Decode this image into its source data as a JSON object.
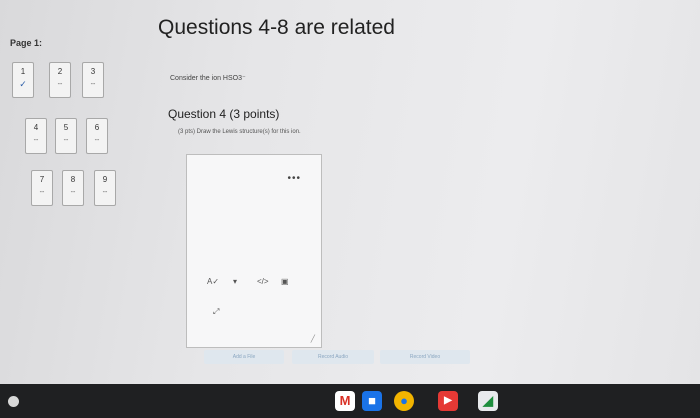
{
  "page_label": "Page 1:",
  "title": "Questions 4-8 are related",
  "prompt": "Consider the ion HSO3⁻",
  "question": {
    "heading": "Question 4 (3 points)",
    "sub": "(3 pts) Draw the Lewis structure(s) for this ion."
  },
  "nav": [
    {
      "num": "1",
      "status": "✓"
    },
    {
      "num": "2",
      "status": "--"
    },
    {
      "num": "3",
      "status": "--"
    },
    {
      "num": "4",
      "status": "--"
    },
    {
      "num": "5",
      "status": "--"
    },
    {
      "num": "6",
      "status": "--"
    },
    {
      "num": "7",
      "status": "--"
    },
    {
      "num": "8",
      "status": "--"
    },
    {
      "num": "9",
      "status": "--"
    }
  ],
  "editor": {
    "more": "•••",
    "toolbar": {
      "spellcheck": "A✓",
      "color": "▾",
      "code": "</>",
      "image": "▣",
      "fullscreen": "⤢"
    },
    "resize": "╱"
  },
  "buttons": {
    "file": "Add a File",
    "audio": "Record Audio",
    "video": "Record Video"
  },
  "shelf": {
    "gmail": "M",
    "docs": "■",
    "chrome": "●",
    "youtube": "▶",
    "files": "◢"
  }
}
